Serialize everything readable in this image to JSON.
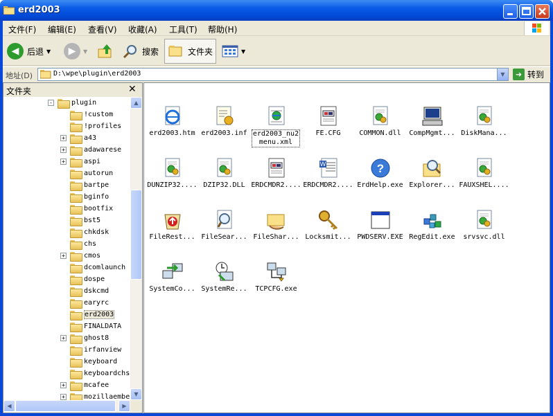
{
  "window": {
    "title": "erd2003"
  },
  "menubar": {
    "items": [
      "文件(F)",
      "编辑(E)",
      "查看(V)",
      "收藏(A)",
      "工具(T)",
      "帮助(H)"
    ]
  },
  "toolbar": {
    "back_label": "后退",
    "search_label": "搜索",
    "folders_label": "文件夹"
  },
  "address": {
    "label": "地址(D)",
    "path": "D:\\wpe\\plugin\\erd2003",
    "go_label": "转到"
  },
  "folder_pane": {
    "title": "文件夹",
    "items": [
      {
        "label": "plugin",
        "expander": "-"
      },
      {
        "label": "!custom",
        "expander": ""
      },
      {
        "label": "!profiles",
        "expander": ""
      },
      {
        "label": "a43",
        "expander": "+"
      },
      {
        "label": "adawarese",
        "expander": "+"
      },
      {
        "label": "aspi",
        "expander": "+"
      },
      {
        "label": "autorun",
        "expander": ""
      },
      {
        "label": "bartpe",
        "expander": ""
      },
      {
        "label": "bginfo",
        "expander": ""
      },
      {
        "label": "bootfix",
        "expander": ""
      },
      {
        "label": "bst5",
        "expander": ""
      },
      {
        "label": "chkdsk",
        "expander": ""
      },
      {
        "label": "chs",
        "expander": ""
      },
      {
        "label": "cmos",
        "expander": "+"
      },
      {
        "label": "dcomlaunch",
        "expander": ""
      },
      {
        "label": "dospe",
        "expander": ""
      },
      {
        "label": "dskcmd",
        "expander": ""
      },
      {
        "label": "earyrc",
        "expander": ""
      },
      {
        "label": "erd2003",
        "expander": "",
        "selected": true
      },
      {
        "label": "FINALDATA",
        "expander": ""
      },
      {
        "label": "ghost8",
        "expander": "+"
      },
      {
        "label": "irfanview",
        "expander": ""
      },
      {
        "label": "keyboard",
        "expander": ""
      },
      {
        "label": "keyboardchs",
        "expander": ""
      },
      {
        "label": "mcafee",
        "expander": "+"
      },
      {
        "label": "mozillaembe",
        "expander": "+"
      }
    ]
  },
  "files": [
    {
      "name": "erd2003.htm",
      "icon": "ie-html-icon"
    },
    {
      "name": "erd2003.inf",
      "icon": "inf-settings-icon"
    },
    {
      "name": "erd2003_nu2menu.xml",
      "icon": "xml-icon",
      "selected": true
    },
    {
      "name": "FE.CFG",
      "icon": "cfg-file-icon"
    },
    {
      "name": "COMMON.dll",
      "icon": "dll-icon"
    },
    {
      "name": "CompMgmt...",
      "icon": "computer-management-icon"
    },
    {
      "name": "DiskMana...",
      "icon": "dll-icon"
    },
    {
      "name": "DUNZIP32....",
      "icon": "dll-icon"
    },
    {
      "name": "DZIP32.DLL",
      "icon": "dll-icon"
    },
    {
      "name": "ERDCMDR2....",
      "icon": "cfg-file-icon"
    },
    {
      "name": "ERDCMDR2....",
      "icon": "word-doc-icon"
    },
    {
      "name": "ErdHelp.exe",
      "icon": "help-icon"
    },
    {
      "name": "Explorer...",
      "icon": "explorer-search-icon"
    },
    {
      "name": "FAUXSHEL....",
      "icon": "dll-icon"
    },
    {
      "name": "FileRest...",
      "icon": "file-restore-icon"
    },
    {
      "name": "FileSear...",
      "icon": "file-search-icon"
    },
    {
      "name": "FileShar...",
      "icon": "file-share-icon"
    },
    {
      "name": "Locksmit...",
      "icon": "key-icon"
    },
    {
      "name": "PWDSERV.EXE",
      "icon": "window-exe-icon"
    },
    {
      "name": "RegEdit.exe",
      "icon": "regedit-icon"
    },
    {
      "name": "srvsvc.dll",
      "icon": "dll-icon"
    },
    {
      "name": "SystemCo...",
      "icon": "system-compare-icon"
    },
    {
      "name": "SystemRe...",
      "icon": "system-restore-icon"
    },
    {
      "name": "TCPCFG.exe",
      "icon": "network-config-icon"
    }
  ]
}
